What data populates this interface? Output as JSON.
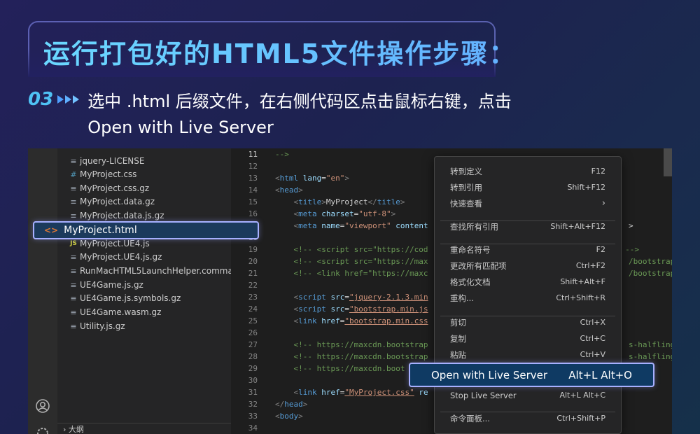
{
  "header": {
    "title": "运行打包好的HTML5文件操作步骤：",
    "step_number": "03",
    "step_line1": "选中 .html 后缀文件，在右侧代码区点击鼠标右键，点击",
    "step_line2": "Open with Live Server"
  },
  "explorer": {
    "files": [
      {
        "name": "jquery-LICENSE",
        "icon": "lines-icon"
      },
      {
        "name": "MyProject.css",
        "icon": "hash-icon"
      },
      {
        "name": "MyProject.css.gz",
        "icon": "lines-icon"
      },
      {
        "name": "MyProject.data.gz",
        "icon": "lines-icon"
      },
      {
        "name": "MyProject.data.js.gz",
        "icon": "lines-icon"
      },
      {
        "name": "MyProject.UE4.js",
        "icon": "js-icon"
      },
      {
        "name": "MyProject.UE4.js.gz",
        "icon": "lines-icon"
      },
      {
        "name": "RunMacHTML5LaunchHelper.command",
        "icon": "lines-icon"
      },
      {
        "name": "UE4Game.js.gz",
        "icon": "lines-icon"
      },
      {
        "name": "UE4Game.js.symbols.gz",
        "icon": "lines-icon"
      },
      {
        "name": "UE4Game.wasm.gz",
        "icon": "lines-icon"
      },
      {
        "name": "Utility.js.gz",
        "icon": "lines-icon"
      }
    ],
    "selected_file": "MyProject.html",
    "outline_label": "大纲"
  },
  "editor": {
    "line_numbers": [
      "11",
      "12",
      "13",
      "14",
      "15",
      "16",
      "17",
      "18",
      "19",
      "20",
      "21",
      "22",
      "23",
      "24",
      "25",
      "26",
      "27",
      "28",
      "29",
      "30",
      "31",
      "32",
      "33",
      "34"
    ],
    "active_line": "11"
  },
  "context_menu": {
    "items": [
      {
        "label": "转到定义",
        "shortcut": "F12"
      },
      {
        "label": "转到引用",
        "shortcut": "Shift+F12"
      },
      {
        "label": "快速查看",
        "shortcut": "›"
      },
      {
        "label": "查找所有引用",
        "shortcut": "Shift+Alt+F12"
      },
      {
        "label": "重命名符号",
        "shortcut": "F2"
      },
      {
        "label": "更改所有匹配项",
        "shortcut": "Ctrl+F2"
      },
      {
        "label": "格式化文档",
        "shortcut": "Shift+Alt+F"
      },
      {
        "label": "重构...",
        "shortcut": "Ctrl+Shift+R"
      },
      {
        "label": "剪切",
        "shortcut": "Ctrl+X"
      },
      {
        "label": "复制",
        "shortcut": "Ctrl+C"
      },
      {
        "label": "粘贴",
        "shortcut": "Ctrl+V"
      },
      {
        "label": "Open with Live Server",
        "shortcut": "Alt+L Alt+O"
      },
      {
        "label": "Stop Live Server",
        "shortcut": "Alt+L Alt+C"
      },
      {
        "label": "命令面板...",
        "shortcut": "Ctrl+Shift+P"
      }
    ]
  },
  "colors": {
    "accent": "#4fc2f5",
    "highlight_border": "#a7b0ff"
  }
}
